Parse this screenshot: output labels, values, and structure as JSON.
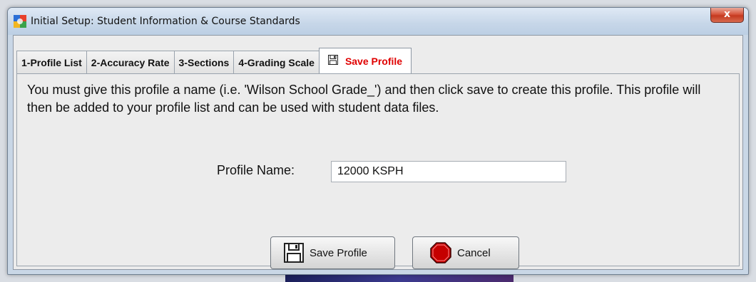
{
  "window": {
    "title": "Initial Setup: Student Information & Course Standards",
    "close_glyph": "x"
  },
  "tabs": [
    {
      "label": "1-Profile List",
      "icon": null
    },
    {
      "label": "2-Accuracy Rate",
      "icon": null
    },
    {
      "label": "3-Sections",
      "icon": null
    },
    {
      "label": "4-Grading Scale",
      "icon": null
    },
    {
      "label": "Save Profile",
      "icon": "floppy-disk-icon",
      "active": true
    }
  ],
  "panel": {
    "message": "You must give this profile a name (i.e. 'Wilson School Grade_') and then click save to create this profile. This profile will then be added to your profile list and can be used with student data files.",
    "profile_name_label": "Profile Name:",
    "profile_name_value": "12000 KSPH"
  },
  "buttons": {
    "save_label": "Save Profile",
    "save_icon": "floppy-disk-icon",
    "cancel_label": "Cancel",
    "cancel_icon": "stop-sign-icon"
  },
  "colors": {
    "active_tab_text": "#e00000",
    "close_button": "#c5391f",
    "stop_sign": "#c50000"
  }
}
